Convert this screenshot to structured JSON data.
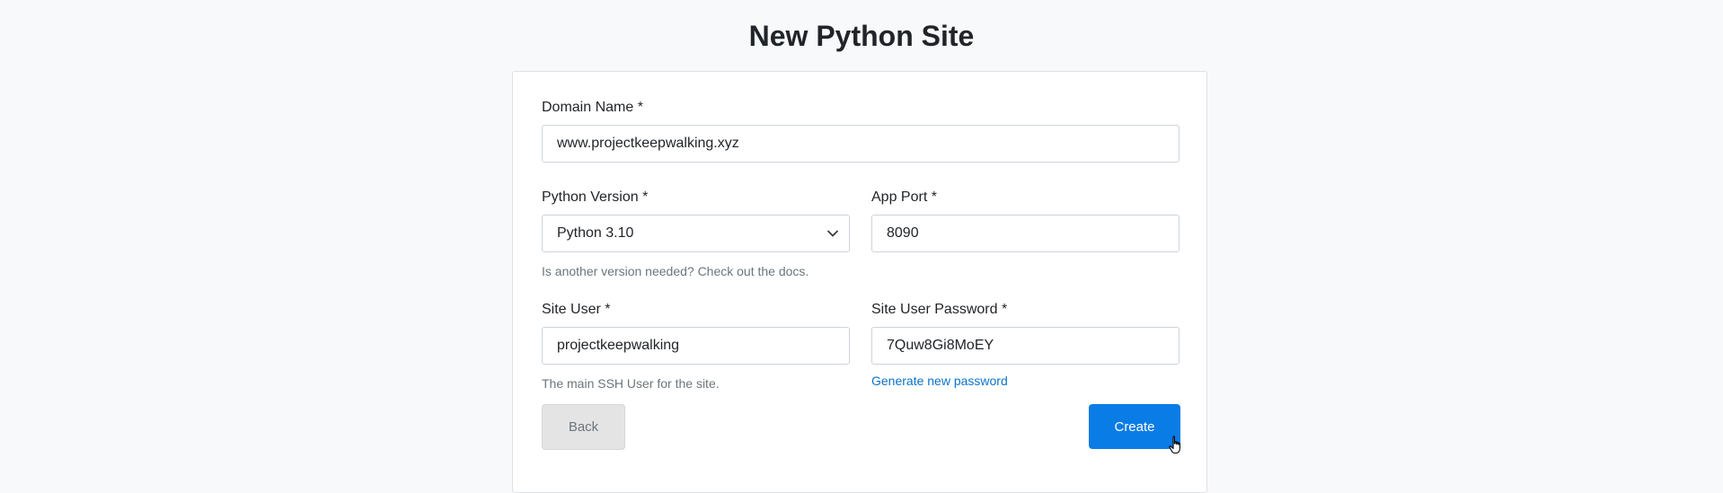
{
  "page": {
    "title": "New Python Site"
  },
  "form": {
    "domain_name": {
      "label": "Domain Name *",
      "value": "www.projectkeepwalking.xyz"
    },
    "python_version": {
      "label": "Python Version *",
      "value": "Python 3.10",
      "help": "Is another version needed? Check out the docs."
    },
    "app_port": {
      "label": "App Port *",
      "value": "8090"
    },
    "site_user": {
      "label": "Site User *",
      "value": "projectkeepwalking",
      "help": "The main SSH User for the site."
    },
    "site_user_password": {
      "label": "Site User Password *",
      "value": "7Quw8Gi8MoEY",
      "generate_link": "Generate new password"
    }
  },
  "actions": {
    "back_label": "Back",
    "create_label": "Create"
  },
  "colors": {
    "primary": "#0a7ce6",
    "link": "#0d73c8",
    "background": "#f8f9fa"
  },
  "icons": {
    "select_arrow": "chevron-down-icon",
    "cursor": "hand-pointer-cursor-icon"
  }
}
